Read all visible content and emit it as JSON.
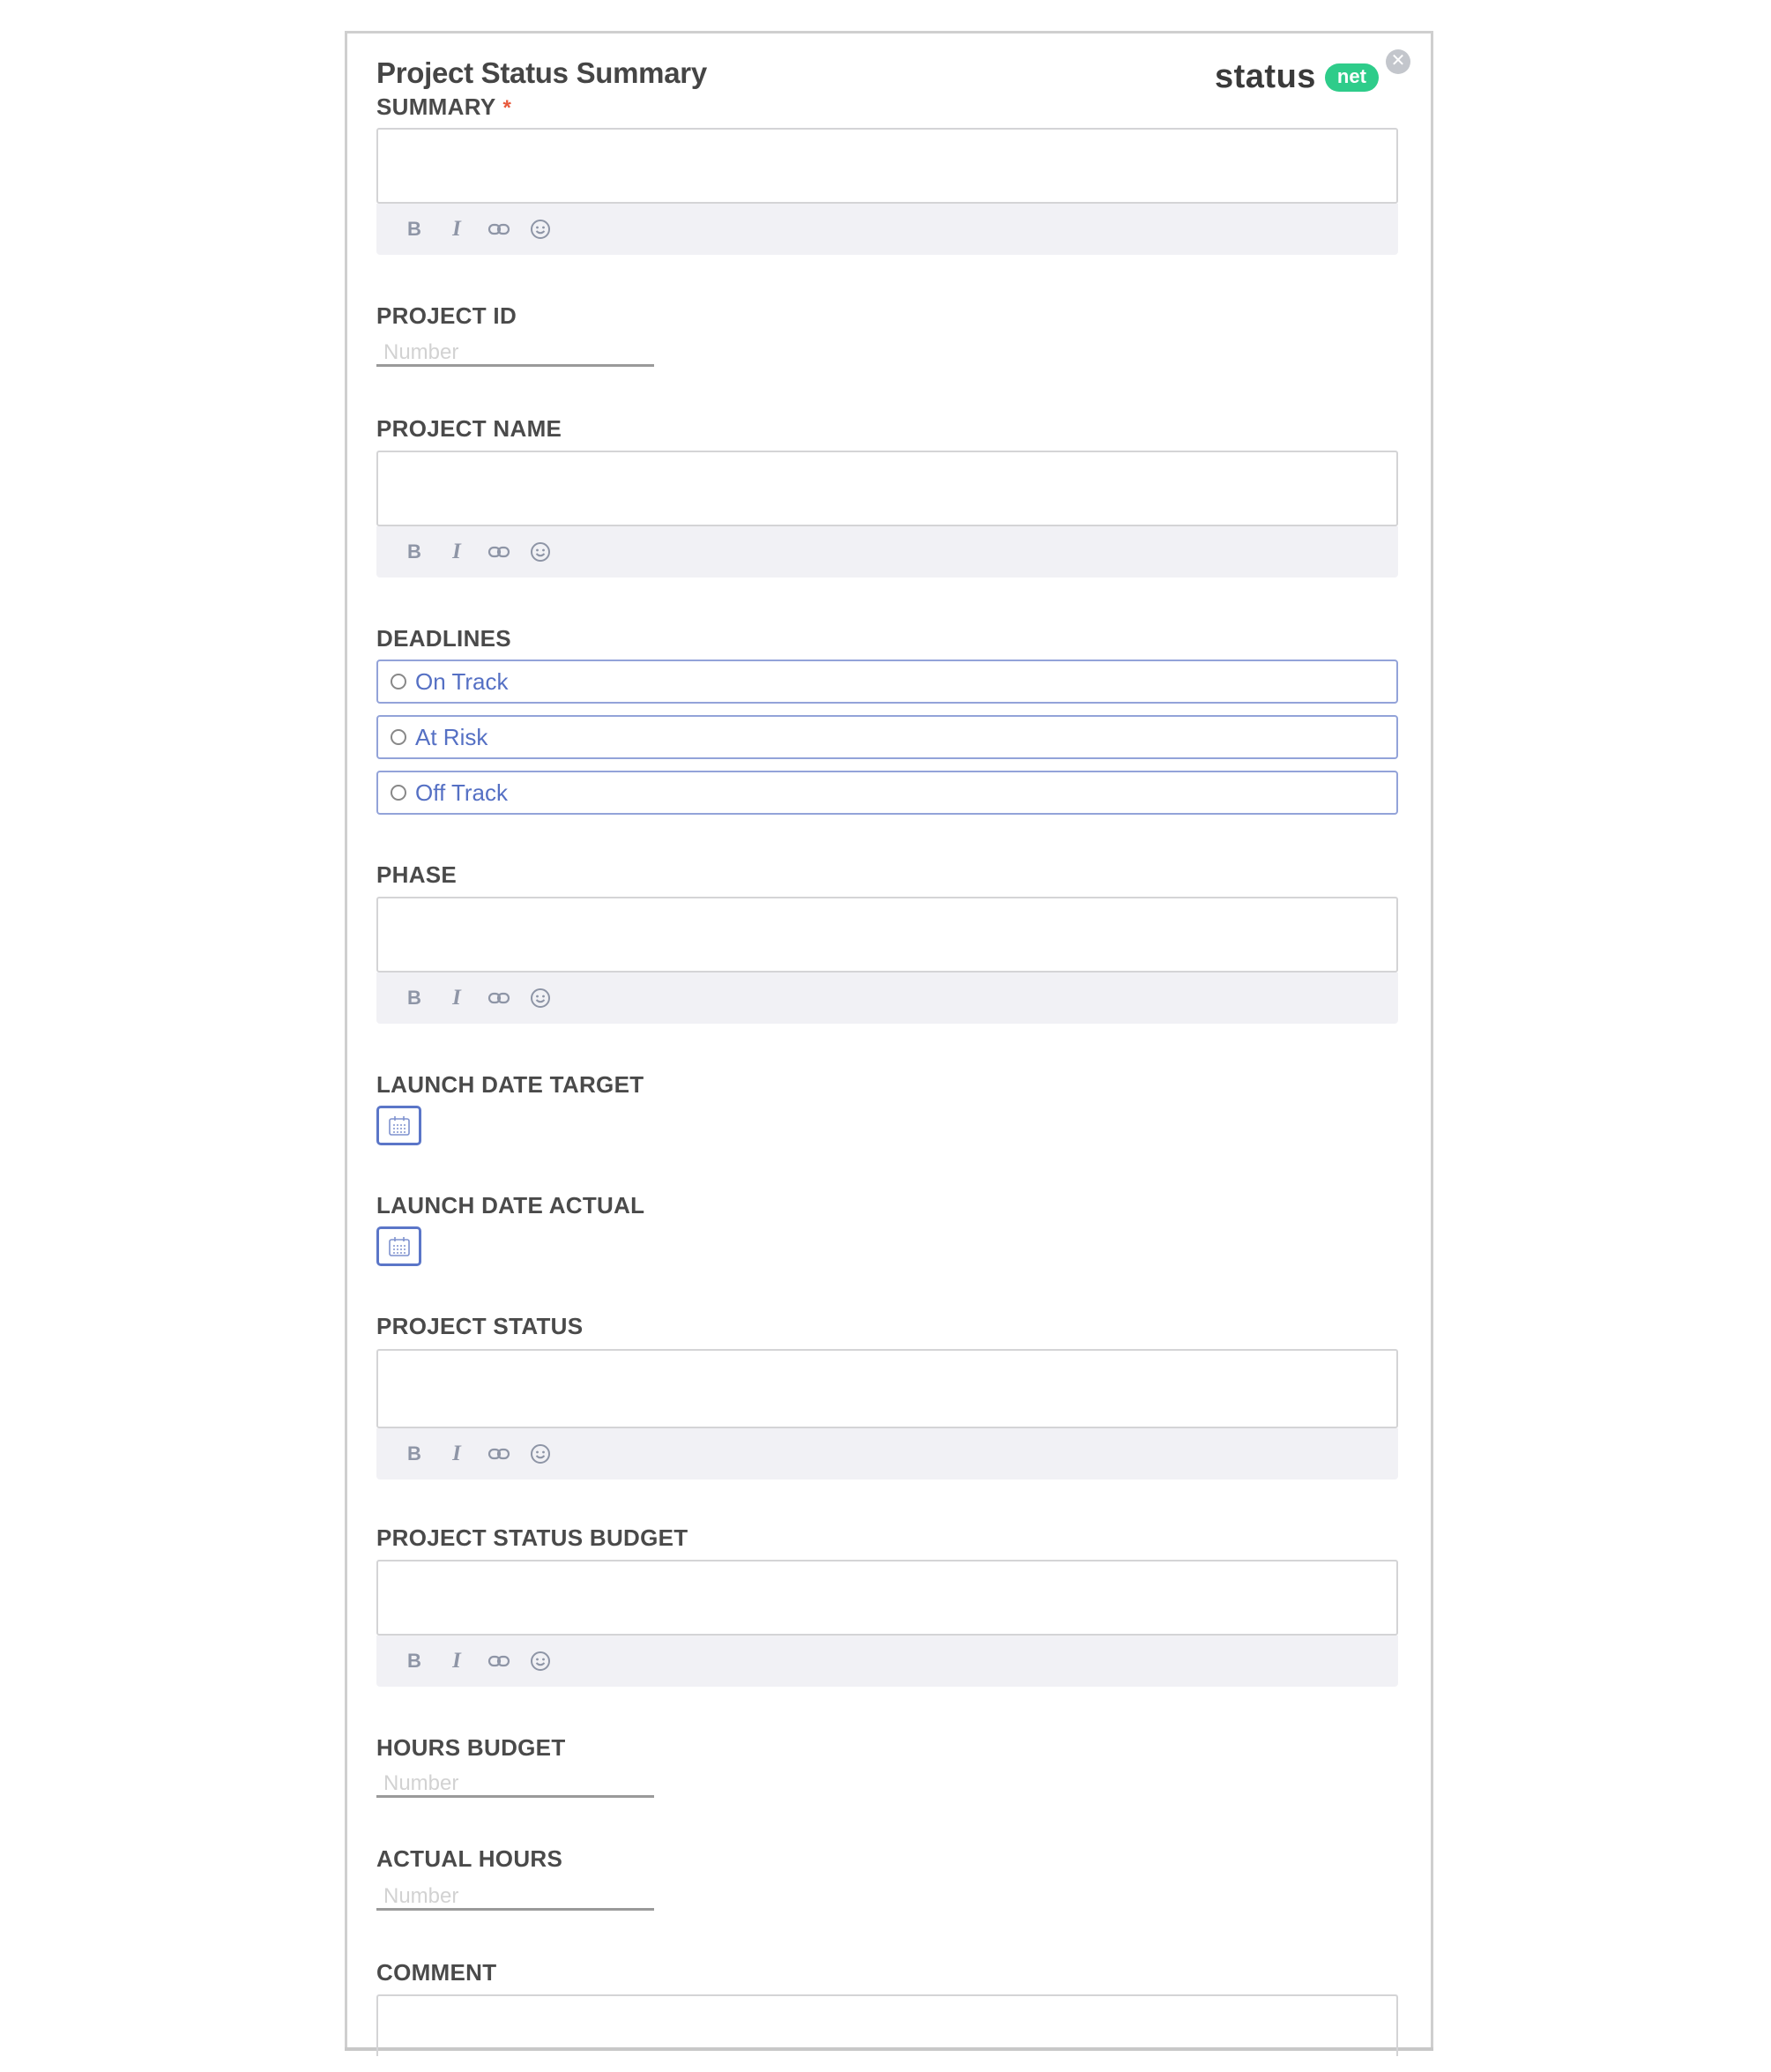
{
  "form": {
    "title": "Project Status Summary",
    "close_icon": "close-icon",
    "logo": {
      "word": "status",
      "badge": "net",
      "badge_color": "#2ecc8a"
    }
  },
  "fields": {
    "summary": {
      "label": "SUMMARY",
      "required_mark": "*",
      "value": ""
    },
    "project_id": {
      "label": "PROJECT ID",
      "placeholder": "Number",
      "value": ""
    },
    "project_name": {
      "label": "PROJECT NAME",
      "value": ""
    },
    "deadlines": {
      "label": "DEADLINES",
      "options": [
        {
          "label": "On Track",
          "selected": false
        },
        {
          "label": "At Risk",
          "selected": false
        },
        {
          "label": "Off Track",
          "selected": false
        }
      ]
    },
    "phase": {
      "label": "PHASE",
      "value": ""
    },
    "launch_date_target": {
      "label": "LAUNCH DATE TARGET",
      "icon": "calendar-icon"
    },
    "launch_date_actual": {
      "label": "LAUNCH DATE ACTUAL",
      "icon": "calendar-icon"
    },
    "project_status": {
      "label": "PROJECT STATUS",
      "value": ""
    },
    "project_status_budget": {
      "label": "PROJECT STATUS BUDGET",
      "value": ""
    },
    "hours_budget": {
      "label": "HOURS BUDGET",
      "placeholder": "Number",
      "value": ""
    },
    "actual_hours": {
      "label": "ACTUAL HOURS",
      "placeholder": "Number",
      "value": ""
    },
    "comment": {
      "label": "COMMENT",
      "value": ""
    }
  },
  "toolbar": {
    "bold": "B",
    "italic": "I",
    "link_icon": "link-icon",
    "emoji_icon": "emoji-icon"
  },
  "colors": {
    "accent": "#5b76c8",
    "option_text": "#5570c4",
    "required": "#e85a3c"
  }
}
